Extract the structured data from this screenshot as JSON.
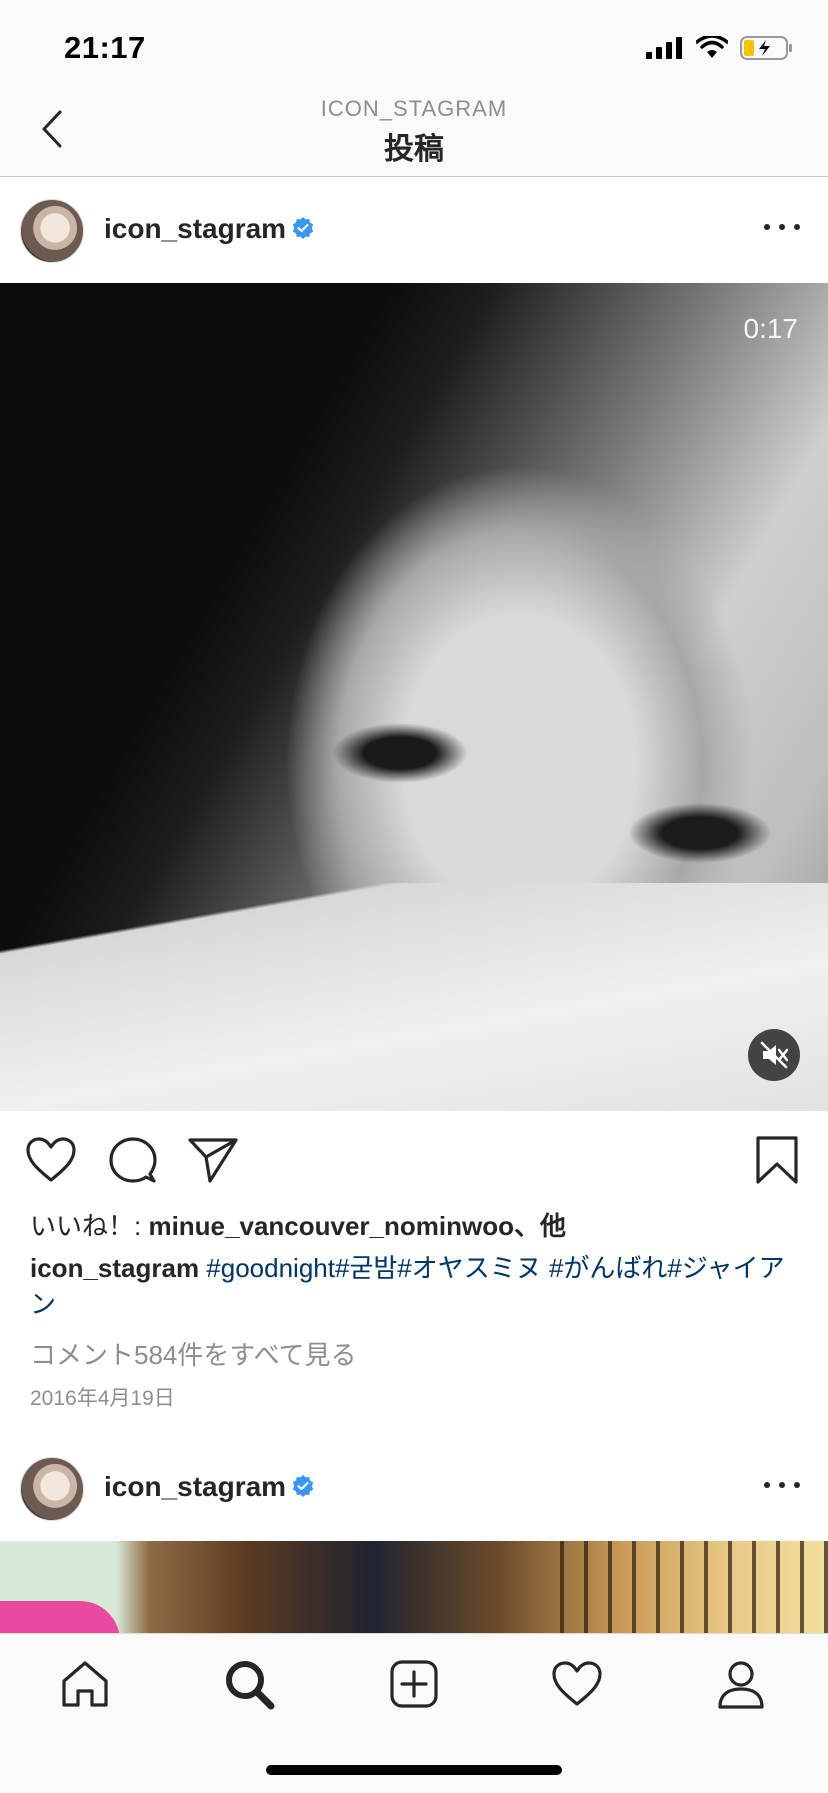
{
  "status_bar": {
    "time": "21:17"
  },
  "nav": {
    "subtitle": "ICON_STAGRAM",
    "title": "投稿"
  },
  "post1": {
    "username": "icon_stagram",
    "video_time": "0:17",
    "likes_prefix": "いいね！: ",
    "likes_user": "minue_vancouver_nominwoo",
    "likes_suffix": "、他",
    "caption_user": "icon_stagram",
    "caption_tags": " #goodnight#굳밤#オヤスミヌ #がんばれ#ジャイアン",
    "view_comments": "コメント584件をすべて見る",
    "date": "2016年4月19日"
  },
  "post2": {
    "username": "icon_stagram"
  },
  "colors": {
    "verified": "#3897f0",
    "hashtag": "#003569",
    "muted_text": "#8e8e8e"
  },
  "icons": [
    "back-icon",
    "verified-icon",
    "more-icon",
    "heart-icon",
    "comment-icon",
    "share-icon",
    "bookmark-icon",
    "mute-icon",
    "home-icon",
    "search-icon",
    "add-icon",
    "activity-icon",
    "profile-icon"
  ]
}
